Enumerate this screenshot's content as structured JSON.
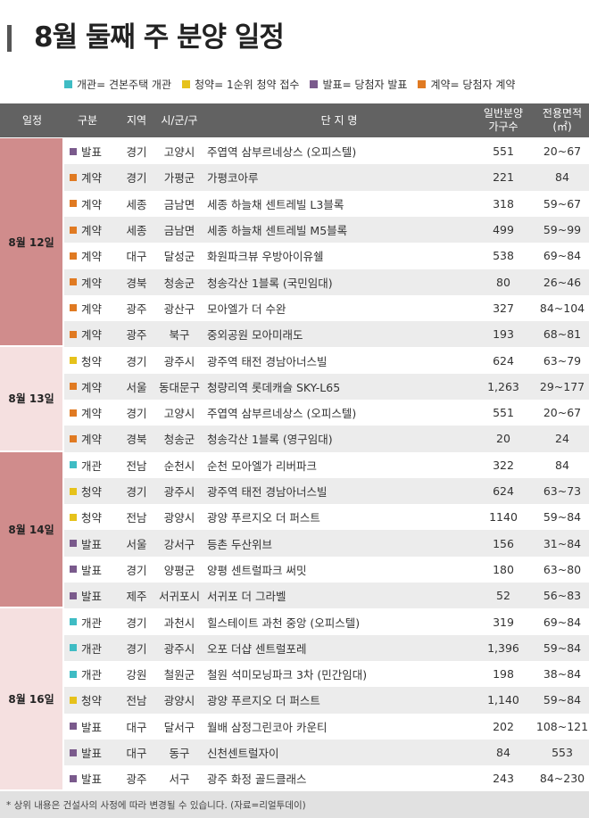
{
  "title": "8월 둘째 주 분양 일정",
  "legend": [
    {
      "label": "개관= 견본주택 개관",
      "color": "#3fbcc4"
    },
    {
      "label": "청약= 1순위 청약 접수",
      "color": "#e6c21b"
    },
    {
      "label": "발표= 당첨자 발표",
      "color": "#7a5a8c"
    },
    {
      "label": "계약= 당첨자 계약",
      "color": "#e07a22"
    }
  ],
  "headers": {
    "date": "일정",
    "type": "구분",
    "region": "지역",
    "city": "시/군/구",
    "complex": "단 지 명",
    "units_line1": "일반분양",
    "units_line2": "가구수",
    "area_line1": "전용면적",
    "area_line2": "(㎡)"
  },
  "type_colors": {
    "개관": "#3fbcc4",
    "청약": "#e6c21b",
    "발표": "#7a5a8c",
    "계약": "#e07a22"
  },
  "groups": [
    {
      "date": "8월 12일",
      "rows": [
        {
          "type": "발표",
          "region": "경기",
          "city": "고양시",
          "complex": "주엽역 삼부르네상스 (오피스텔)",
          "units": "551",
          "area": "20~67"
        },
        {
          "type": "계약",
          "region": "경기",
          "city": "가평군",
          "complex": "가평코아루",
          "units": "221",
          "area": "84"
        },
        {
          "type": "계약",
          "region": "세종",
          "city": "금남면",
          "complex": "세종 하늘채 센트레빌 L3블록",
          "units": "318",
          "area": "59~67"
        },
        {
          "type": "계약",
          "region": "세종",
          "city": "금남면",
          "complex": "세종 하늘채 센트레빌 M5블록",
          "units": "499",
          "area": "59~99"
        },
        {
          "type": "계약",
          "region": "대구",
          "city": "달성군",
          "complex": "화원파크뷰 우방아이유쉘",
          "units": "538",
          "area": "69~84"
        },
        {
          "type": "계약",
          "region": "경북",
          "city": "청송군",
          "complex": "청송각산 1블록 (국민임대)",
          "units": "80",
          "area": "26~46"
        },
        {
          "type": "계약",
          "region": "광주",
          "city": "광산구",
          "complex": "모아엘가 더 수완",
          "units": "327",
          "area": "84~104"
        },
        {
          "type": "계약",
          "region": "광주",
          "city": "북구",
          "complex": "중외공원 모아미래도",
          "units": "193",
          "area": "68~81"
        }
      ]
    },
    {
      "date": "8월 13일",
      "rows": [
        {
          "type": "청약",
          "region": "경기",
          "city": "광주시",
          "complex": "광주역 태전 경남아너스빌",
          "units": "624",
          "area": "63~79"
        },
        {
          "type": "계약",
          "region": "서울",
          "city": "동대문구",
          "complex": "청량리역 롯데캐슬 SKY-L65",
          "units": "1,263",
          "area": "29~177"
        },
        {
          "type": "계약",
          "region": "경기",
          "city": "고양시",
          "complex": "주엽역 삼부르네상스 (오피스텔)",
          "units": "551",
          "area": "20~67"
        },
        {
          "type": "계약",
          "region": "경북",
          "city": "청송군",
          "complex": "청송각산 1블록 (영구임대)",
          "units": "20",
          "area": "24"
        }
      ]
    },
    {
      "date": "8월 14일",
      "rows": [
        {
          "type": "개관",
          "region": "전남",
          "city": "순천시",
          "complex": "순천 모아엘가 리버파크",
          "units": "322",
          "area": "84"
        },
        {
          "type": "청약",
          "region": "경기",
          "city": "광주시",
          "complex": "광주역 태전 경남아너스빌",
          "units": "624",
          "area": "63~73"
        },
        {
          "type": "청약",
          "region": "전남",
          "city": "광양시",
          "complex": "광양 푸르지오 더 퍼스트",
          "units": "1140",
          "area": "59~84"
        },
        {
          "type": "발표",
          "region": "서울",
          "city": "강서구",
          "complex": "등촌 두산위브",
          "units": "156",
          "area": "31~84"
        },
        {
          "type": "발표",
          "region": "경기",
          "city": "양평군",
          "complex": "양평 센트럴파크 써밋",
          "units": "180",
          "area": "63~80"
        },
        {
          "type": "발표",
          "region": "제주",
          "city": "서귀포시",
          "complex": "서귀포 더 그라벨",
          "units": "52",
          "area": "56~83"
        }
      ]
    },
    {
      "date": "8월 16일",
      "rows": [
        {
          "type": "개관",
          "region": "경기",
          "city": "과천시",
          "complex": "힐스테이트 과천 중앙 (오피스텔)",
          "units": "319",
          "area": "69~84"
        },
        {
          "type": "개관",
          "region": "경기",
          "city": "광주시",
          "complex": "오포 더샵 센트럴포레",
          "units": "1,396",
          "area": "59~84"
        },
        {
          "type": "개관",
          "region": "강원",
          "city": "철원군",
          "complex": "철원 석미모닝파크 3차 (민간임대)",
          "units": "198",
          "area": "38~84"
        },
        {
          "type": "청약",
          "region": "전남",
          "city": "광양시",
          "complex": "광양 푸르지오 더 퍼스트",
          "units": "1,140",
          "area": "59~84"
        },
        {
          "type": "발표",
          "region": "대구",
          "city": "달서구",
          "complex": "월배 삼정그린코아 카운티",
          "units": "202",
          "area": "108~121"
        },
        {
          "type": "발표",
          "region": "대구",
          "city": "동구",
          "complex": "신천센트럴자이",
          "units": "84",
          "area": "553"
        },
        {
          "type": "발표",
          "region": "광주",
          "city": "서구",
          "complex": "광주 화정 골드클래스",
          "units": "243",
          "area": "84~230"
        }
      ]
    }
  ],
  "group_colors": [
    "#d08c8c",
    "#f5e0e0",
    "#d08c8c",
    "#f5e0e0"
  ],
  "footer": "* 상위 내용은 건설사의 사정에 따라 변경될 수 있습니다. (자료=리얼투데이)"
}
